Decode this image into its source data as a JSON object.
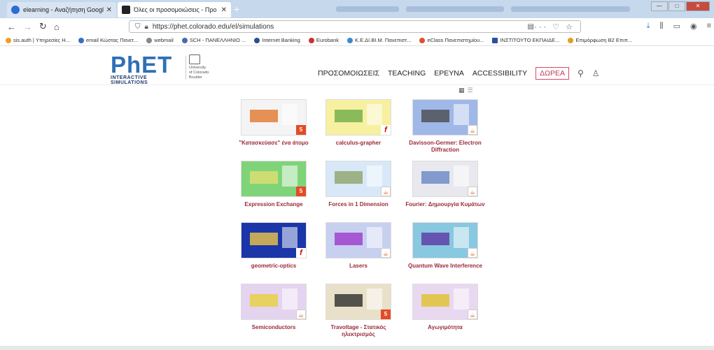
{
  "browser": {
    "tabs": [
      {
        "title": "elearning - Αναζήτηση Google",
        "active": false
      },
      {
        "title": "Όλες οι προσομοιώσεις - Προ",
        "active": true
      }
    ],
    "url": "https://phet.colorado.edu/el/simulations",
    "bookmarks": [
      "sis.auth | Υπηρεσίες Η...",
      "email Κώστας Πανετ...",
      "webmail",
      "SCH - ΠΑΝΕΛΛΗΝΙΟ ...",
      "Internet Banking",
      "Eurobank",
      "Κ.Ε.ΔΙ.ΒΙ.Μ. Πανεπιστ...",
      "eClass Πανεπιστημίου...",
      "ΙΝΣΤΙΤΟΥΤΟ ΕΚΠΑΙΔΕ...",
      "Επιμόρφωση Β2 Επιπ..."
    ]
  },
  "header": {
    "logo_main": "PhET",
    "logo_sub": "INTERACTIVE SIMULATIONS",
    "university": [
      "University",
      "of Colorado",
      "Boulder"
    ],
    "menu": [
      "ΠΡΟΣΟΜΟΙΩΣΕΙΣ",
      "TEACHING",
      "ΕΡΕΥΝΑ",
      "ACCESSIBILITY"
    ],
    "donate": "ΔΩΡΕΑ"
  },
  "simulations": [
    {
      "label": "\"Κατασκεύασε\" ένα άτομο",
      "badge": "html5",
      "bg": "#f4f4f4",
      "accent": "#e07020"
    },
    {
      "label": "calculus-grapher",
      "badge": "flash",
      "bg": "#f6f0a0",
      "accent": "#66aa44"
    },
    {
      "label": "Davisson-Germer: Electron Diffraction",
      "badge": "java",
      "bg": "#9fb8e8",
      "accent": "#444"
    },
    {
      "label": "Expression Exchange",
      "badge": "html5",
      "bg": "#7fd47a",
      "accent": "#e8e070"
    },
    {
      "label": "Forces in 1 Dimension",
      "badge": "java",
      "bg": "#d8e8f8",
      "accent": "#8aa060"
    },
    {
      "label": "Fourier: Δημιουργία Κυμάτων",
      "badge": "java",
      "bg": "#e8e8ee",
      "accent": "#6080c0"
    },
    {
      "label": "geometric-optics",
      "badge": "flash",
      "bg": "#1a36a8",
      "accent": "#ffd040"
    },
    {
      "label": "Lasers",
      "badge": "java",
      "bg": "#c8d0f0",
      "accent": "#9b30c8"
    },
    {
      "label": "Quantum Wave Interference",
      "badge": "java",
      "bg": "#88c8e0",
      "accent": "#5a2fa0"
    },
    {
      "label": "Semiconductors",
      "badge": "java",
      "bg": "#e4d4f0",
      "accent": "#e8d030"
    },
    {
      "label": "Travoltage - Στατικός ηλεκτρισμός",
      "badge": "html5",
      "bg": "#e8e0c8",
      "accent": "#222"
    },
    {
      "label": "Αγωγιμότητα",
      "badge": "java",
      "bg": "#e8d8f0",
      "accent": "#e0c020"
    }
  ]
}
